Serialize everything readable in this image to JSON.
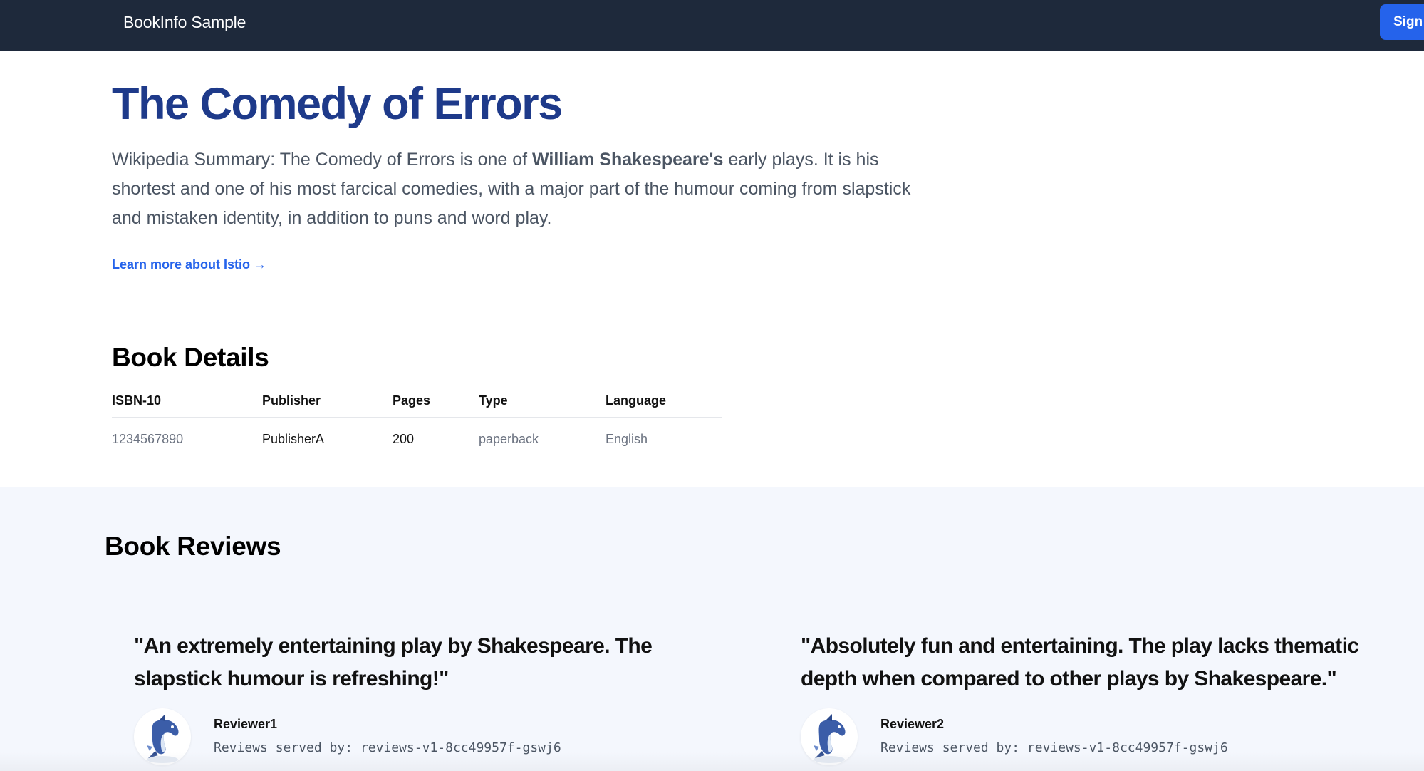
{
  "navbar": {
    "brand": "BookInfo Sample",
    "signin_label": "Sign in"
  },
  "book": {
    "title": "The Comedy of Errors",
    "summary_before": "Wikipedia Summary: The Comedy of Errors is one of ",
    "summary_bold": "William Shakespeare's",
    "summary_after": " early plays. It is his shortest and one of his most farcical comedies, with a major part of the humour coming from slapstick and mistaken identity, in addition to puns and word play.",
    "learn_more": "Learn more about Istio →"
  },
  "details": {
    "title": "Book Details",
    "headers": {
      "isbn": "ISBN-10",
      "publisher": "Publisher",
      "pages": "Pages",
      "type": "Type",
      "language": "Language"
    },
    "row": {
      "isbn": "1234567890",
      "publisher": "PublisherA",
      "pages": "200",
      "type": "paperback",
      "language": "English"
    }
  },
  "reviews": {
    "title": "Book Reviews",
    "items": [
      {
        "text": "\"An extremely entertaining play by Shakespeare. The slapstick humour is refreshing!\"",
        "reviewer": "Reviewer1",
        "served_by": "Reviews served by: reviews-v1-8cc49957f-gswj6",
        "avatar_icon": "dolphin-icon"
      },
      {
        "text": "\"Absolutely fun and entertaining. The play lacks thematic depth when compared to other plays by Shakespeare.\"",
        "reviewer": "Reviewer2",
        "served_by": "Reviews served by: reviews-v1-8cc49957f-gswj6",
        "avatar_icon": "dolphin-icon"
      }
    ]
  },
  "colors": {
    "navbar_bg": "#1e293b",
    "accent": "#2563eb",
    "title": "#1e3a8a",
    "reviews_bg": "#f4f7fd"
  }
}
